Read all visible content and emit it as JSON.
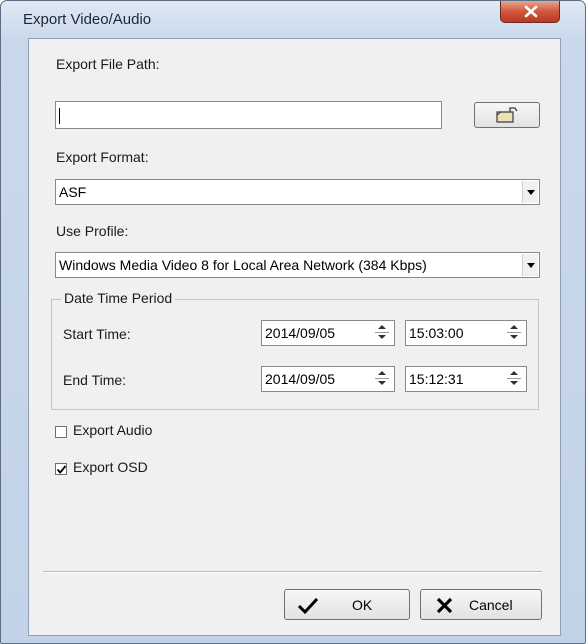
{
  "window": {
    "title": "Export Video/Audio"
  },
  "file_path": {
    "label": "Export File Path:",
    "value": "",
    "browse_icon": "folder-open-icon"
  },
  "format": {
    "label": "Export Format:",
    "selected": "ASF"
  },
  "profile": {
    "label": "Use Profile:",
    "selected": "Windows Media Video 8 for Local Area Network (384 Kbps)"
  },
  "period": {
    "legend": "Date Time Period",
    "start": {
      "label": "Start Time:",
      "date": "2014/09/05",
      "time": "15:03:00"
    },
    "end": {
      "label": "End Time:",
      "date": "2014/09/05",
      "time": "15:12:31"
    }
  },
  "options": {
    "export_audio": {
      "label": "Export Audio",
      "checked": false
    },
    "export_osd": {
      "label": "Export OSD",
      "checked": true
    }
  },
  "buttons": {
    "ok": "OK",
    "cancel": "Cancel"
  }
}
